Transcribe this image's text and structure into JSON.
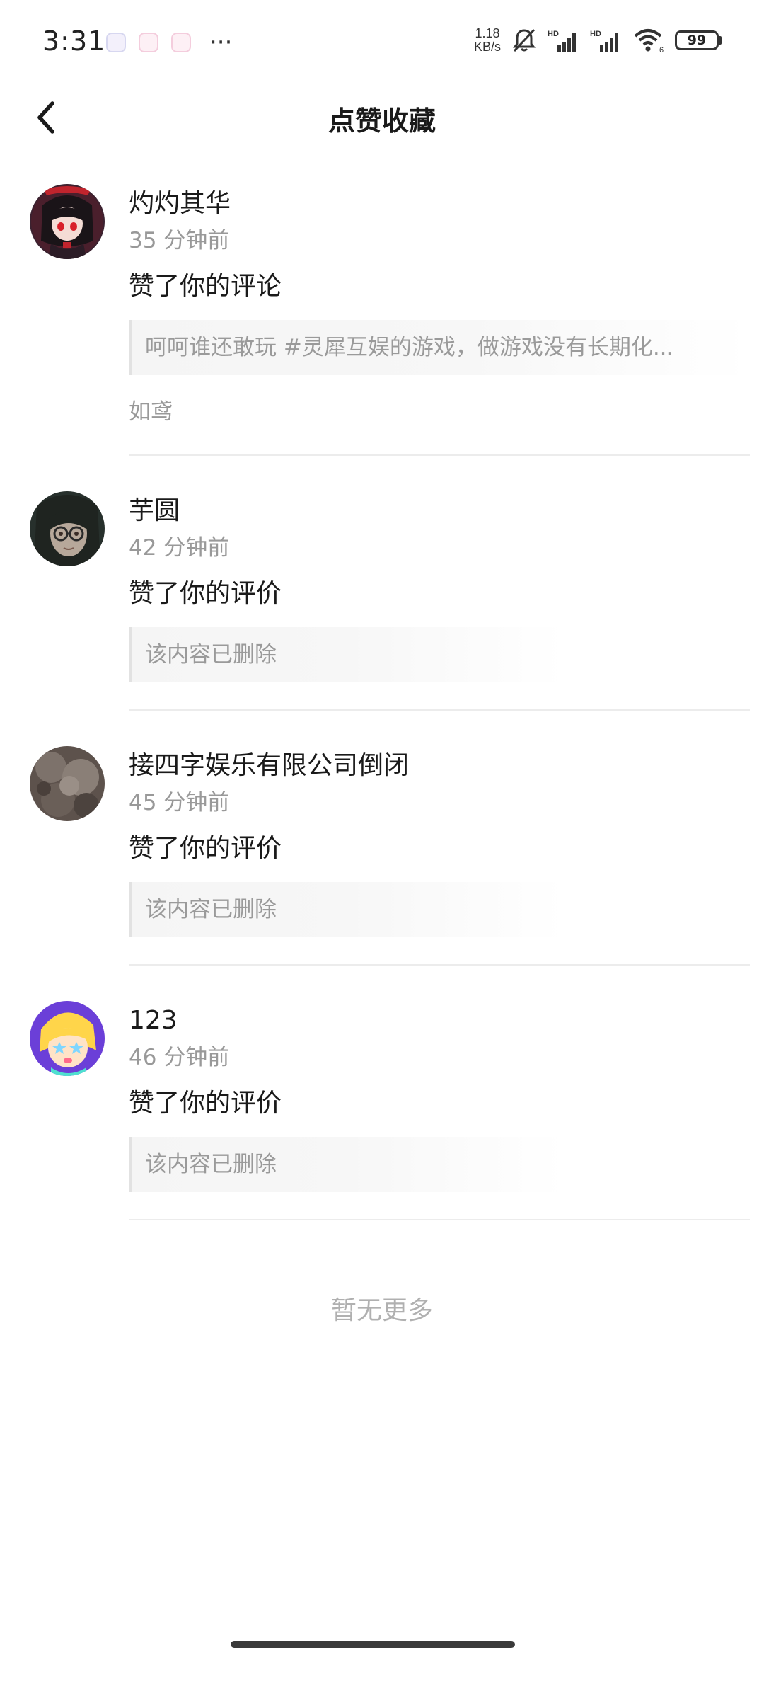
{
  "status_bar": {
    "time": "3:31",
    "more": "···",
    "net_speed_value": "1.18",
    "net_speed_unit": "KB/s",
    "signal_label_1": "HD",
    "signal_label_2": "HD",
    "wifi_label": "6",
    "battery": "99",
    "icons": [
      "app-notification-icon",
      "app-notification-icon",
      "app-notification-icon",
      "mute-bell-icon",
      "cellular-signal-icon",
      "wifi-icon",
      "battery-icon"
    ]
  },
  "header": {
    "title": "点赞收藏",
    "back_icon": "chevron-left-icon"
  },
  "notifications": [
    {
      "username": "灼灼其华",
      "time": "35 分钟前",
      "action": "赞了你的评论",
      "quote": "呵呵谁还敢玩 #灵犀互娱的游戏，做游戏没有长期化...",
      "source": "如鸢"
    },
    {
      "username": "芋圆",
      "time": "42 分钟前",
      "action": "赞了你的评价",
      "quote": "该内容已删除"
    },
    {
      "username": "接四字娱乐有限公司倒闭",
      "time": "45 分钟前",
      "action": "赞了你的评价",
      "quote": "该内容已删除"
    },
    {
      "username": "123",
      "time": "46 分钟前",
      "action": "赞了你的评价",
      "quote": "该内容已删除"
    }
  ],
  "footer": {
    "end_text": "暂无更多"
  },
  "colors": {
    "text_primary": "#1a1a1a",
    "text_secondary": "#999999",
    "divider": "#ececec",
    "quote_bar": "#e2e2e2"
  }
}
